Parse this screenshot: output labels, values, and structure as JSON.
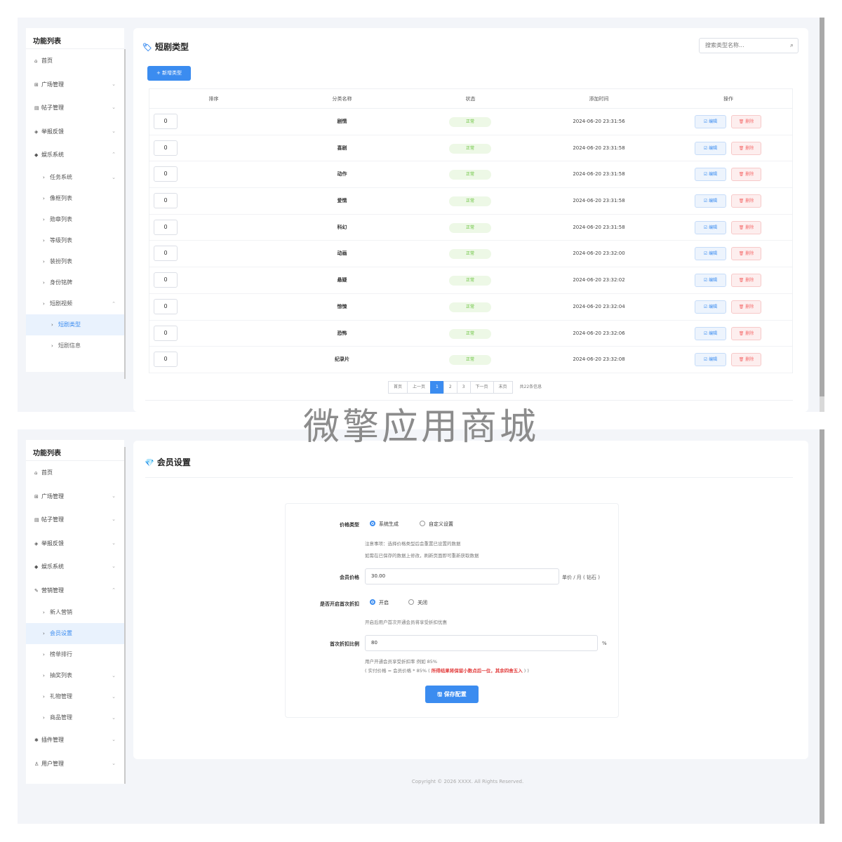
{
  "sidebar_top": {
    "title": "功能列表",
    "items": [
      {
        "icon": "home-icon",
        "glyph": "⌂",
        "label": "首页",
        "level": 0,
        "chevron": ""
      },
      {
        "icon": "square-icon",
        "glyph": "⊞",
        "label": "广场管理",
        "level": 0,
        "chevron": "⌄"
      },
      {
        "icon": "doc-icon",
        "glyph": "▤",
        "label": "帖子管理",
        "level": 0,
        "chevron": "⌄"
      },
      {
        "icon": "shield-icon",
        "glyph": "◈",
        "label": "举报反馈",
        "level": 0,
        "chevron": "⌄"
      },
      {
        "icon": "tag-icon",
        "glyph": "◆",
        "label": "娱乐系统",
        "level": 0,
        "chevron": "⌃"
      },
      {
        "icon": "chevron-right-icon",
        "glyph": "›",
        "label": "任务系统",
        "level": 1,
        "chevron": "⌄"
      },
      {
        "icon": "chevron-right-icon",
        "glyph": "›",
        "label": "像框列表",
        "level": 1,
        "chevron": ""
      },
      {
        "icon": "chevron-right-icon",
        "glyph": "›",
        "label": "勋章列表",
        "level": 1,
        "chevron": ""
      },
      {
        "icon": "chevron-right-icon",
        "glyph": "›",
        "label": "等级列表",
        "level": 1,
        "chevron": ""
      },
      {
        "icon": "chevron-right-icon",
        "glyph": "›",
        "label": "装扮列表",
        "level": 1,
        "chevron": ""
      },
      {
        "icon": "chevron-right-icon",
        "glyph": "›",
        "label": "身份铭牌",
        "level": 1,
        "chevron": ""
      },
      {
        "icon": "chevron-right-icon",
        "glyph": "›",
        "label": "短剧视频",
        "level": 1,
        "chevron": "⌃"
      },
      {
        "icon": "chevron-right-icon",
        "glyph": "›",
        "label": "短剧类型",
        "level": 2,
        "chevron": "",
        "active": true
      },
      {
        "icon": "chevron-right-icon",
        "glyph": "›",
        "label": "短剧信息",
        "level": 2,
        "chevron": ""
      }
    ]
  },
  "top_card": {
    "title": "短剧类型",
    "search_placeholder": "搜索类型名称...",
    "add_button": "+ 新增类型",
    "headers": [
      "排序",
      "分类名称",
      "状态",
      "添加时间",
      "操作"
    ],
    "edit_label": "☑ 编辑",
    "delete_label": "🗑 删除",
    "rows": [
      {
        "sort": "0",
        "name": "剧情",
        "status": "正常",
        "time": "2024-06-20 23:31:56"
      },
      {
        "sort": "0",
        "name": "喜剧",
        "status": "正常",
        "time": "2024-06-20 23:31:58"
      },
      {
        "sort": "0",
        "name": "动作",
        "status": "正常",
        "time": "2024-06-20 23:31:58"
      },
      {
        "sort": "0",
        "name": "爱情",
        "status": "正常",
        "time": "2024-06-20 23:31:58"
      },
      {
        "sort": "0",
        "name": "科幻",
        "status": "正常",
        "time": "2024-06-20 23:31:58"
      },
      {
        "sort": "0",
        "name": "动画",
        "status": "正常",
        "time": "2024-06-20 23:32:00"
      },
      {
        "sort": "0",
        "name": "悬疑",
        "status": "正常",
        "time": "2024-06-20 23:32:02"
      },
      {
        "sort": "0",
        "name": "惊悚",
        "status": "正常",
        "time": "2024-06-20 23:32:04"
      },
      {
        "sort": "0",
        "name": "恐怖",
        "status": "正常",
        "time": "2024-06-20 23:32:06"
      },
      {
        "sort": "0",
        "name": "纪录片",
        "status": "正常",
        "time": "2024-06-20 23:32:08"
      }
    ],
    "pagination": {
      "first": "首页",
      "prev": "上一页",
      "pages": [
        "1",
        "2",
        "3"
      ],
      "current": "1",
      "next": "下一页",
      "last": "末页",
      "info": "共22条信息"
    }
  },
  "watermark": "微擎应用商城",
  "sidebar_bottom": {
    "title": "功能列表",
    "items": [
      {
        "icon": "home-icon",
        "glyph": "⌂",
        "label": "首页",
        "level": 0,
        "chevron": ""
      },
      {
        "icon": "square-icon",
        "glyph": "⊞",
        "label": "广场管理",
        "level": 0,
        "chevron": "⌄"
      },
      {
        "icon": "doc-icon",
        "glyph": "▤",
        "label": "帖子管理",
        "level": 0,
        "chevron": "⌄"
      },
      {
        "icon": "shield-icon",
        "glyph": "◈",
        "label": "举报反馈",
        "level": 0,
        "chevron": "⌄"
      },
      {
        "icon": "tag-icon",
        "glyph": "◆",
        "label": "娱乐系统",
        "level": 0,
        "chevron": "⌄"
      },
      {
        "icon": "brush-icon",
        "glyph": "✎",
        "label": "营销管理",
        "level": 0,
        "chevron": "⌃"
      },
      {
        "icon": "chevron-right-icon",
        "glyph": "›",
        "label": "新人营销",
        "level": 1,
        "chevron": ""
      },
      {
        "icon": "chevron-right-icon",
        "glyph": "›",
        "label": "会员设置",
        "level": 1,
        "chevron": "",
        "active": true
      },
      {
        "icon": "chevron-right-icon",
        "glyph": "›",
        "label": "榜单排行",
        "level": 1,
        "chevron": ""
      },
      {
        "icon": "chevron-right-icon",
        "glyph": "›",
        "label": "抽奖列表",
        "level": 1,
        "chevron": "⌄"
      },
      {
        "icon": "chevron-right-icon",
        "glyph": "›",
        "label": "礼物管理",
        "level": 1,
        "chevron": "⌄"
      },
      {
        "icon": "chevron-right-icon",
        "glyph": "›",
        "label": "商品管理",
        "level": 1,
        "chevron": "⌄"
      },
      {
        "icon": "plugin-icon",
        "glyph": "✱",
        "label": "插件管理",
        "level": 0,
        "chevron": "⌄"
      },
      {
        "icon": "user-icon",
        "glyph": "♙",
        "label": "用户管理",
        "level": 0,
        "chevron": "⌄"
      }
    ]
  },
  "member_card": {
    "title": "会员设置",
    "price_type_label": "价格类型",
    "price_type_options": [
      "系统生成",
      "自定义设置"
    ],
    "price_type_selected": 0,
    "notice_line1": "注意事项：选择价格类型后会重置已设置的数据",
    "notice_line2": "如需在已保存的数据上修改，刷新页面即可重新获取数据",
    "member_price_label": "会员价格",
    "member_price_value": "30.00",
    "member_price_unit": "单价 / 月 ( 钻石 )",
    "first_discount_label": "是否开启首次折扣",
    "first_discount_options": [
      "开启",
      "关闭"
    ],
    "first_discount_selected": 0,
    "first_discount_hint": "开启后用户首次开通会员将享受折扣优惠",
    "discount_ratio_label": "首次折扣比例",
    "discount_ratio_value": "80",
    "discount_ratio_unit": "%",
    "ratio_hint1": "用户开通会员享受折扣率 例如 85%",
    "ratio_hint2_prefix": "( 实付价格 = 会员价格 * 85% ( ",
    "ratio_hint2_red": "所得结果将保留小数点后一位，其余四舍五入",
    "ratio_hint2_suffix": " ) )",
    "save_button": "🖫 保存配置"
  },
  "footer": "Copyright © 2026 XXXX. All Rights Reserved."
}
